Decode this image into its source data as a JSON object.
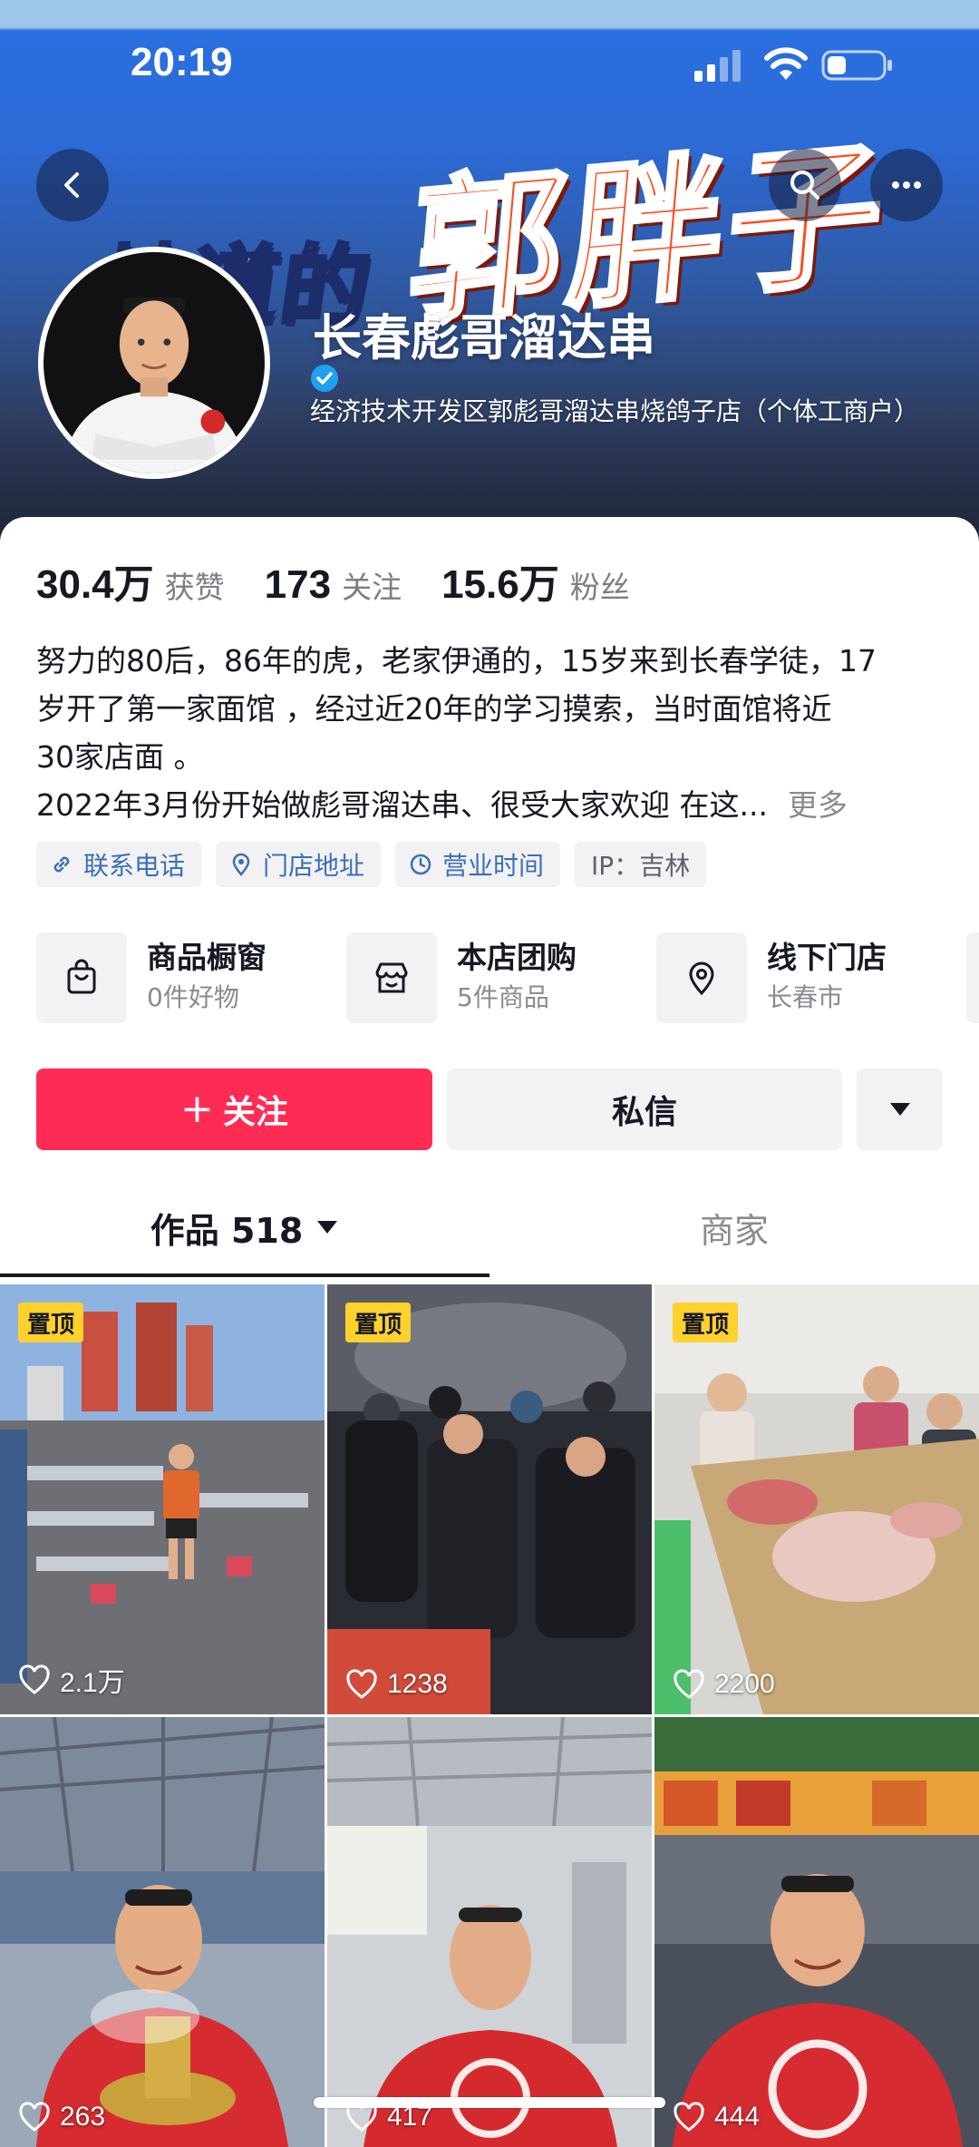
{
  "status_bar": {
    "time": "20:19"
  },
  "banner": {
    "art_text_left": "地道的",
    "art_text_right": "郭胖子"
  },
  "profile": {
    "name": "长春彪哥溜达串",
    "verification": "经济技术开发区郭彪哥溜达串烧鸽子店（个体工商户）"
  },
  "stats": [
    {
      "number": "30.4万",
      "label": "获赞"
    },
    {
      "number": "173",
      "label": "关注"
    },
    {
      "number": "15.6万",
      "label": "粉丝"
    }
  ],
  "bio": {
    "lines": [
      "努力的80后，86年的虎，老家伊通的，15岁来到长春学徒，17",
      "岁开了第一家面馆 ，经过近20年的学习摸索，当时面馆将近",
      "30家店面 。",
      "2022年3月份开始做彪哥溜达串、很受大家欢迎 在这..."
    ],
    "more": "更多"
  },
  "chips": [
    {
      "label": "联系电话",
      "icon": "link-icon"
    },
    {
      "label": "门店地址",
      "icon": "location-pin-icon"
    },
    {
      "label": "营业时间",
      "icon": "clock-icon"
    },
    {
      "label": "IP：吉林",
      "icon": ""
    }
  ],
  "services": [
    {
      "title": "商品橱窗",
      "subtitle": "0件好物",
      "icon": "shopping-bag-icon"
    },
    {
      "title": "本店团购",
      "subtitle": "5件商品",
      "icon": "storefront-icon"
    },
    {
      "title": "线下门店",
      "subtitle": "长春市",
      "icon": "location-pin-icon"
    }
  ],
  "actions": {
    "follow": "关注",
    "message": "私信"
  },
  "tabs": {
    "works": "作品 518",
    "merchant": "商家"
  },
  "videos": [
    {
      "pinned": "置顶",
      "likes": "2.1万"
    },
    {
      "pinned": "置顶",
      "likes": "1238"
    },
    {
      "pinned": "置顶",
      "likes": "2200"
    },
    {
      "pinned": "",
      "likes": "263"
    },
    {
      "pinned": "",
      "likes": "417"
    },
    {
      "pinned": "",
      "likes": "444"
    }
  ],
  "colors": {
    "accent": "#fe2c55",
    "link": "#3b6fb6",
    "pin_badge": "#fed12d",
    "verify": "#20a0f0"
  }
}
